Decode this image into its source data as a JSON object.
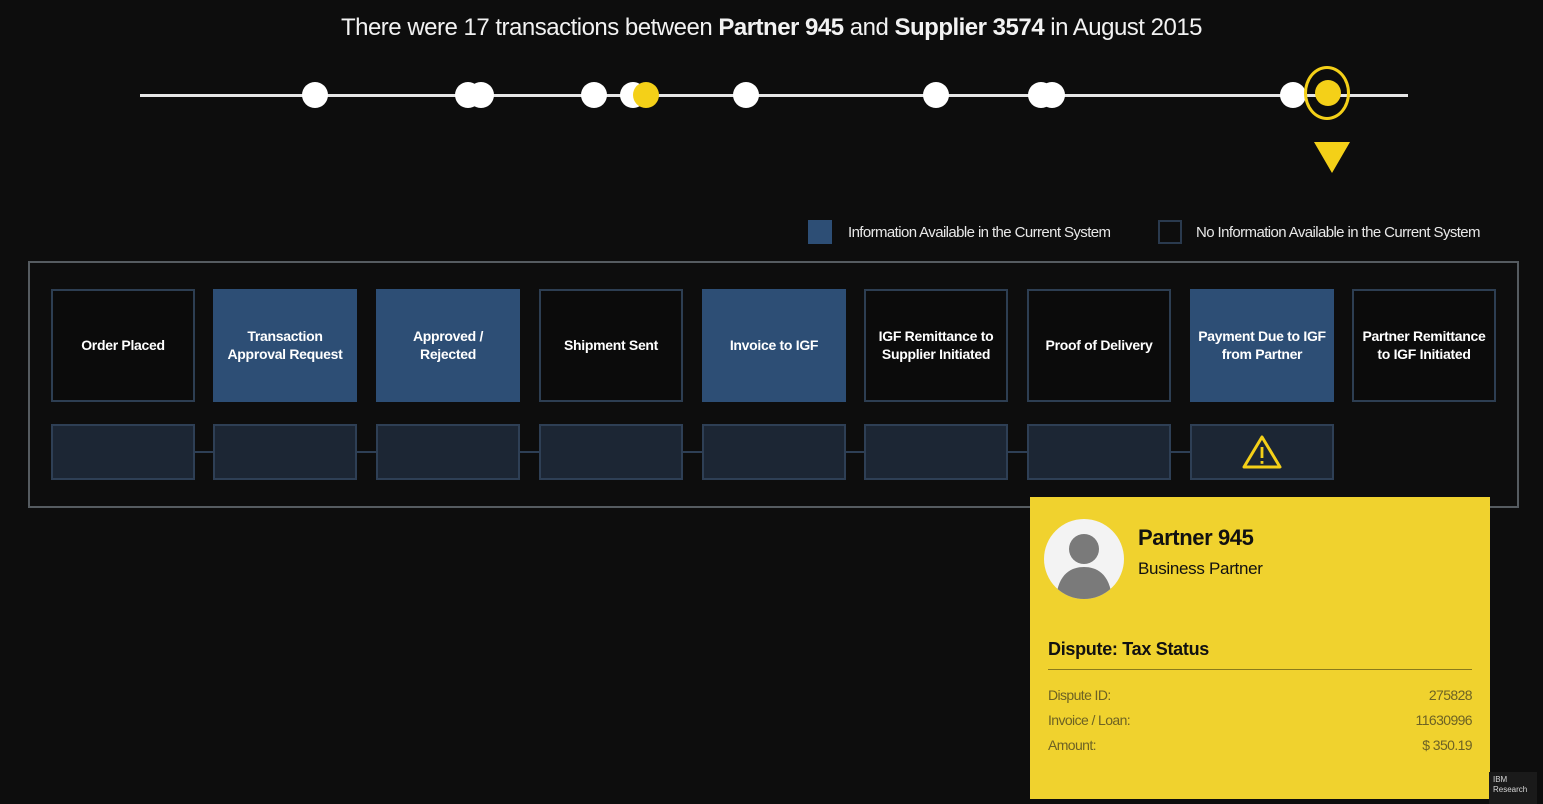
{
  "headline": {
    "prefix": "There were 17 transactions between ",
    "partner": "Partner 945",
    "middle": " and ",
    "supplier": "Supplier 3574",
    "suffix": " in August 2015"
  },
  "timeline": {
    "selected_color": "#f4d018",
    "default_color": "#ffffff"
  },
  "legend": {
    "available_label": "Information Available in the Current System",
    "unavailable_label": "No Information Available in the Current System",
    "available_color": "#2d4e75"
  },
  "steps": [
    {
      "label": "Order Placed",
      "available": false
    },
    {
      "label": "Transaction Approval Request",
      "available": true
    },
    {
      "label": "Approved / Rejected",
      "available": true
    },
    {
      "label": "Shipment Sent",
      "available": false
    },
    {
      "label": "Invoice to IGF",
      "available": true
    },
    {
      "label": "IGF Remittance to Supplier Initiated",
      "available": false
    },
    {
      "label": "Proof of Delivery",
      "available": false
    },
    {
      "label": "Payment Due to IGF from Partner",
      "available": true
    },
    {
      "label": "Partner Remittance to IGF Initiated",
      "available": false
    }
  ],
  "status_icons": {
    "warning": "warning-triangle-icon"
  },
  "popup": {
    "name": "Partner 945",
    "role": "Business Partner",
    "dispute_title": "Dispute: Tax Status",
    "rows": [
      {
        "label": "Dispute ID:",
        "value": "275828"
      },
      {
        "label": "Invoice / Loan:",
        "value": "11630996"
      },
      {
        "label": "Amount:",
        "value": "$ 350.19"
      }
    ],
    "background": "#f0d22e"
  },
  "watermark": {
    "line1": "IBM",
    "line2": "Research"
  }
}
